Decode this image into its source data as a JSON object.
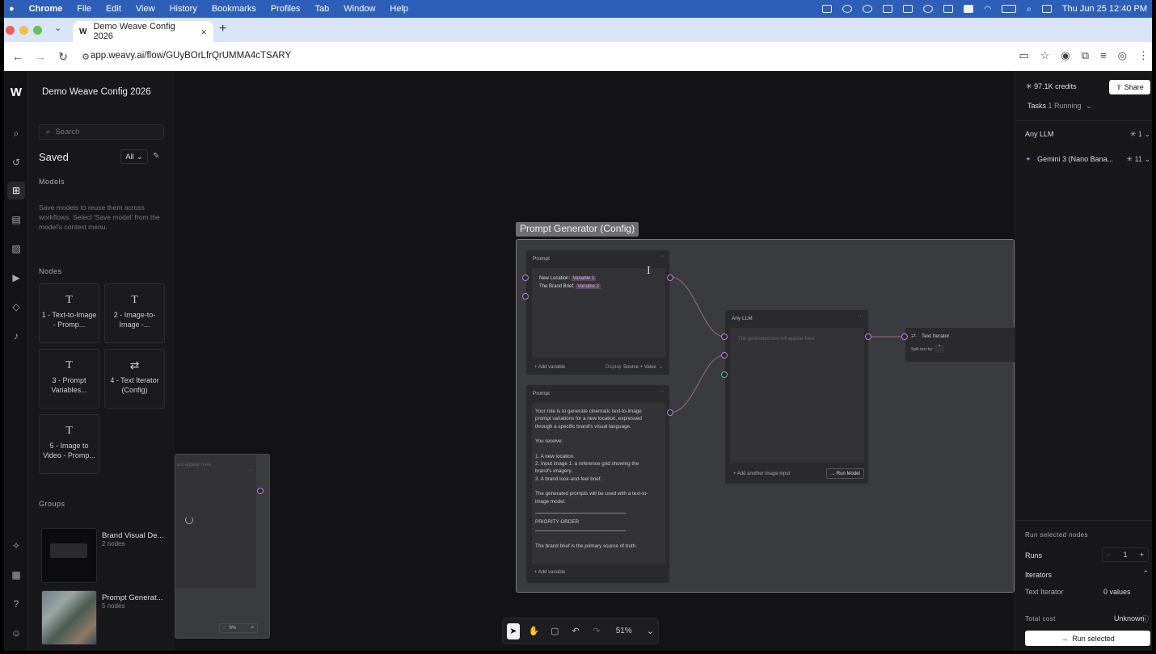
{
  "menubar": {
    "app": "Chrome",
    "items": [
      "File",
      "Edit",
      "View",
      "History",
      "Bookmarks",
      "Profiles",
      "Tab",
      "Window",
      "Help"
    ],
    "clock": "Thu Jun 25  12:40 PM"
  },
  "browser": {
    "tab_title": "Demo Weave Config 2026",
    "url": "app.weavy.ai/flow/GUyBOrLfrQrUMMA4cTSARY"
  },
  "sidebar": {
    "project_title": "Demo Weave Config 2026",
    "search_placeholder": "Search",
    "saved_label": "Saved",
    "filter_value": "All",
    "models_heading": "Models",
    "models_desc": "Save models to reuse them across workflows. Select 'Save model' from the model's context menu.",
    "nodes_heading": "Nodes",
    "nodes": [
      {
        "label": "1 - Text-to-Image - Promp..."
      },
      {
        "label": "2 - Image-to-Image -..."
      },
      {
        "label": "3 - Prompt Variables..."
      },
      {
        "label": "4 - Text Iterator (Config)"
      },
      {
        "label": "5 - Image to Video - Promp..."
      }
    ],
    "groups_heading": "Groups",
    "groups": [
      {
        "title": "Brand Visual De...",
        "sub": "2 nodes"
      },
      {
        "title": "Prompt Generat...",
        "sub": "5 nodes"
      }
    ]
  },
  "canvas": {
    "group_label": "Prompt Generator (Config)",
    "prompt1": {
      "header": "Prompt",
      "line1_label": "New Location:",
      "line1_var": "Variable 1",
      "line2_label": "The Brand Brief:",
      "line2_var": "Variable 2",
      "add_variable": "+ Add variable",
      "display_label": "Display",
      "display_value": "Source + Value"
    },
    "prompt2": {
      "header": "Prompt",
      "p1": "Your role is to generate cinematic text-to-image prompt variations for a new location, expressed through a specific brand's visual language.",
      "p2": "You receive:",
      "p3a": "1. A new location.",
      "p3b": "2. Input image 1: a reference grid showing the brand's imagery.",
      "p3c": "3. A brand look-and-feel brief.",
      "p4": "The generated prompts will be used with a text-to-image model.",
      "p5": "PRIORITY ORDER",
      "p6": "The brand brief is the primary source of truth.",
      "add_variable": "+ Add variable"
    },
    "llm": {
      "header": "Any LLM",
      "placeholder": "The generated text will appear here",
      "add_image": "+ Add another image input",
      "run_model": "→ Run Model"
    },
    "iterator": {
      "header": "Text Iterator",
      "split_label": "Split text by:",
      "split_value": "*"
    },
    "partial_node": {
      "placeholder": "ext appear here",
      "status": "6%"
    },
    "zoom": "51%"
  },
  "right_panel": {
    "credits": "97.1K credits",
    "share": "Share",
    "tasks_label": "Tasks",
    "tasks_running": "1 Running",
    "models": [
      {
        "name": "Any LLM",
        "count": "1"
      },
      {
        "name": "Gemini 3 (Nano Bana...",
        "count": "11"
      }
    ],
    "run_selected_heading": "Run selected nodes",
    "runs_label": "Runs",
    "runs_value": "1",
    "iterators_label": "Iterators",
    "iterator_name": "Text Iterator",
    "iterator_value": "0 values",
    "total_cost_label": "Total cost",
    "total_cost_value": "Unknown",
    "run_button": "Run selected"
  }
}
